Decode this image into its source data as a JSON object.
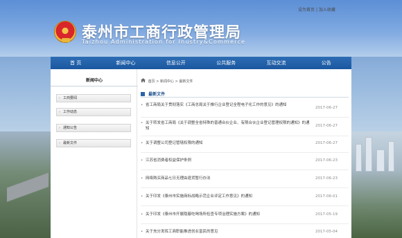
{
  "header": {
    "top_links": [
      "设为首页",
      "加入收藏"
    ],
    "top_links_separator": "|",
    "title": "泰州市工商行政管理局",
    "subtitle": "Taizhou Administration for Inustry&Commerce"
  },
  "nav": {
    "items": [
      "首 页",
      "新闻中心",
      "信息公开",
      "公共服务",
      "互动交流",
      "公告"
    ]
  },
  "sidebar": {
    "heading": "新闻中心",
    "items": [
      "工商要闻",
      "工作动态",
      "通知公告",
      "最新文件"
    ]
  },
  "breadcrumb": {
    "home": "首页",
    "items": [
      "新闻中心",
      "最新文件"
    ],
    "separator": ">"
  },
  "section": {
    "title": "最新文件"
  },
  "articles": [
    {
      "title": "省工商局关于贯彻落实《工商总局关于推行企业登记全程电子化工作的意见》的通知",
      "date": "2017-06-27"
    },
    {
      "title": "关于转发省工商局《关于调整全省特殊的普通合伙企业、有限合伙企业登记管理权限的通知》的通知",
      "date": "2017-06-27"
    },
    {
      "title": "关于调整公司登记管辖权限的通知",
      "date": "2017-06-27"
    },
    {
      "title": "江苏省消费者权益保护条例",
      "date": "2017-06-23"
    },
    {
      "title": "网络购买商品七日无理由退货暂行办法",
      "date": "2017-06-23"
    },
    {
      "title": "关于印发《泰州市实施商标战略示范企业评定工作意见》的通知",
      "date": "2017-06-01"
    },
    {
      "title": "关于印发《泰州市开展隐蔽吃喝场所检查专项治理实施方案》的通知",
      "date": "2017-05-19"
    },
    {
      "title": "关于充分发挥工商职能推进创业富民的意见",
      "date": "2017-05-04"
    }
  ],
  "colors": {
    "nav_bg": "#1f5fa8",
    "section_title": "#1d4f8e"
  }
}
